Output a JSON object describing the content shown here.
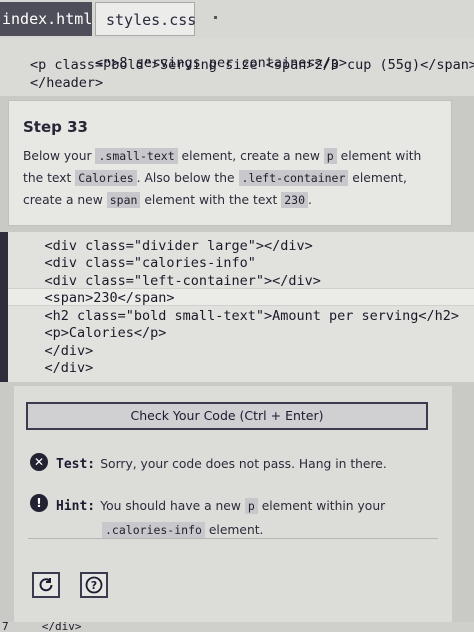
{
  "tabs": [
    {
      "label": "index.html",
      "active": true
    },
    {
      "label": "styles.css",
      "active": false
    }
  ],
  "editor_top": {
    "lines": [
      {
        "indent": "    ",
        "text_open": "<p>",
        "text": "8 servings per container",
        "text_close": "</p>"
      },
      {
        "indent": "    ",
        "text": "<p class=\"bold\">Serving size <span>2/3 cup (55g)</span>"
      },
      {
        "indent": "  ",
        "text": "</header>"
      }
    ]
  },
  "instructions": {
    "title": "Step 33",
    "parts": {
      "p1": "Below your ",
      "c1": ".small-text",
      "p2": " element, create a new ",
      "c2": "p",
      "p3": " element with the text ",
      "c3": "Calories",
      "p4": ". Also below the ",
      "c4": ".left-container",
      "p5": " element, create a new ",
      "c5": "span",
      "p6": " element with the text ",
      "c6": "230",
      "p7": "."
    }
  },
  "editor_main": {
    "lines": [
      "    <div class=\"divider large\"></div>",
      "    <div class=\"calories-info\"",
      "    <div class=\"left-container\"></div>",
      "    <span>230</span>",
      "    <h2 class=\"bold small-text\">Amount per serving</h2>",
      "    <p>Calories</p>",
      "    </div>",
      "    </div>"
    ],
    "footer_line": "7     </div>"
  },
  "panel": {
    "check_button": "Check Your Code (Ctrl + Enter)",
    "test": {
      "label": "Test:",
      "message": "Sorry, your code does not pass. Hang in there."
    },
    "hint": {
      "label": "Hint:",
      "message_1": "You should have a new ",
      "chip_1": "p",
      "message_2": " element within your",
      "chip_2": ".calories-info",
      "message_3": " element."
    },
    "reset_icon": "reset-icon",
    "help_icon": "help-icon"
  },
  "colors": {
    "background": "#c9c9c6",
    "panel": "#dcdcd9",
    "text": "#1b1b32",
    "active_tab": "#4e4e5a"
  }
}
